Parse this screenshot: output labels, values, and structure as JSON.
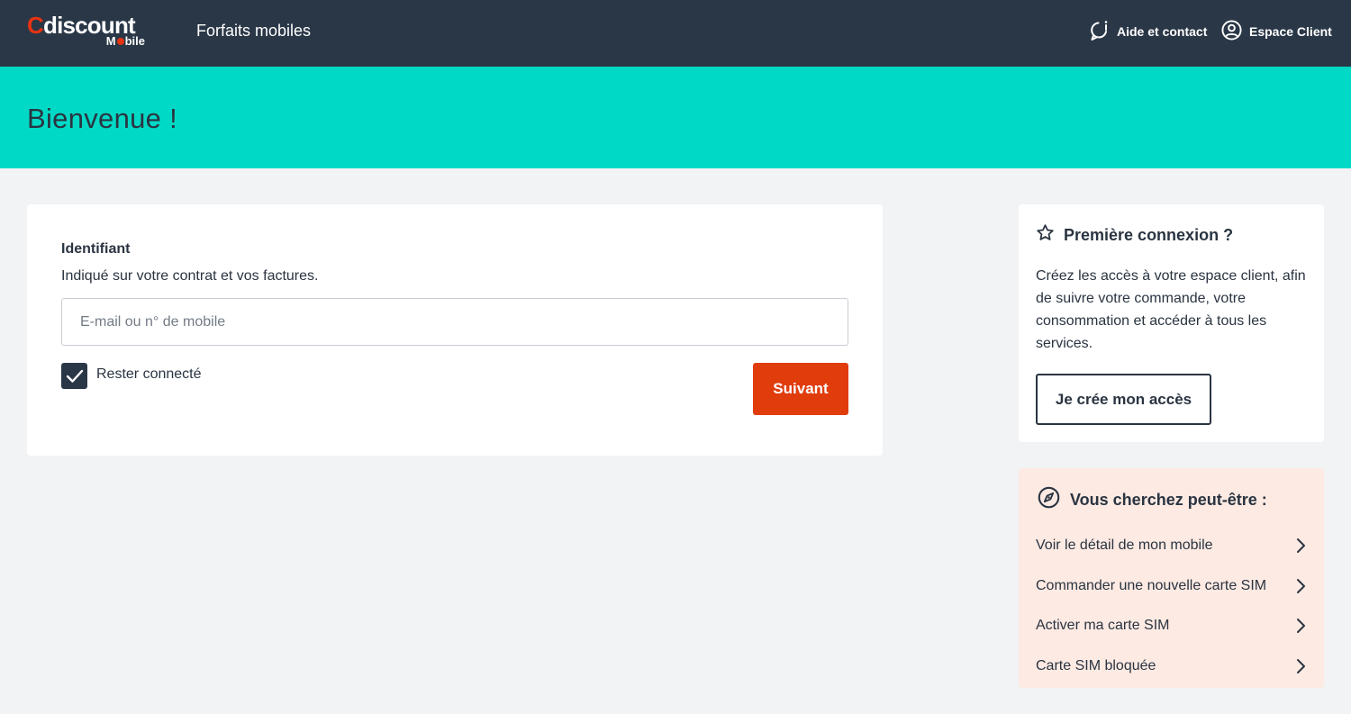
{
  "header": {
    "logo_word_first": "C",
    "logo_word_rest": "discount",
    "logo_sub_first": "M",
    "logo_sub_rest": "bile",
    "nav_forfaits": "Forfaits mobiles",
    "nav_aide": "Aide et contact",
    "nav_espace": "Espace Client",
    "icons": {
      "help": "chat-bubble-info-icon",
      "account": "user-circle-icon"
    }
  },
  "banner": {
    "title": "Bienvenue !"
  },
  "login": {
    "label": "Identifiant",
    "hint": "Indiqué sur votre contrat et vos factures.",
    "input_placeholder": "E-mail ou n° de mobile",
    "input_value": "",
    "remember_label": "Rester connecté",
    "remember_checked": true,
    "next_button": "Suivant"
  },
  "first_connection": {
    "title": "Première connexion ?",
    "text": "Créez les accès à votre espace client, afin de suivre votre commande, votre consommation et accéder à tous les services.",
    "button": "Je crée mon accès",
    "icon": "star-outline-icon"
  },
  "suggestions": {
    "title": "Vous cherchez peut-être :",
    "icon": "compass-icon",
    "items": [
      {
        "label": "Voir le détail de mon mobile"
      },
      {
        "label": "Commander une nouvelle carte SIM"
      },
      {
        "label": "Activer ma carte SIM"
      },
      {
        "label": "Carte SIM bloquée"
      }
    ]
  },
  "colors": {
    "header_bg": "#2a3747",
    "banner_bg": "#00d9c5",
    "primary_button": "#e03c0c",
    "logo_accent": "#e63312",
    "suggest_bg": "#fdeae3",
    "page_bg": "#f2f3f4"
  }
}
